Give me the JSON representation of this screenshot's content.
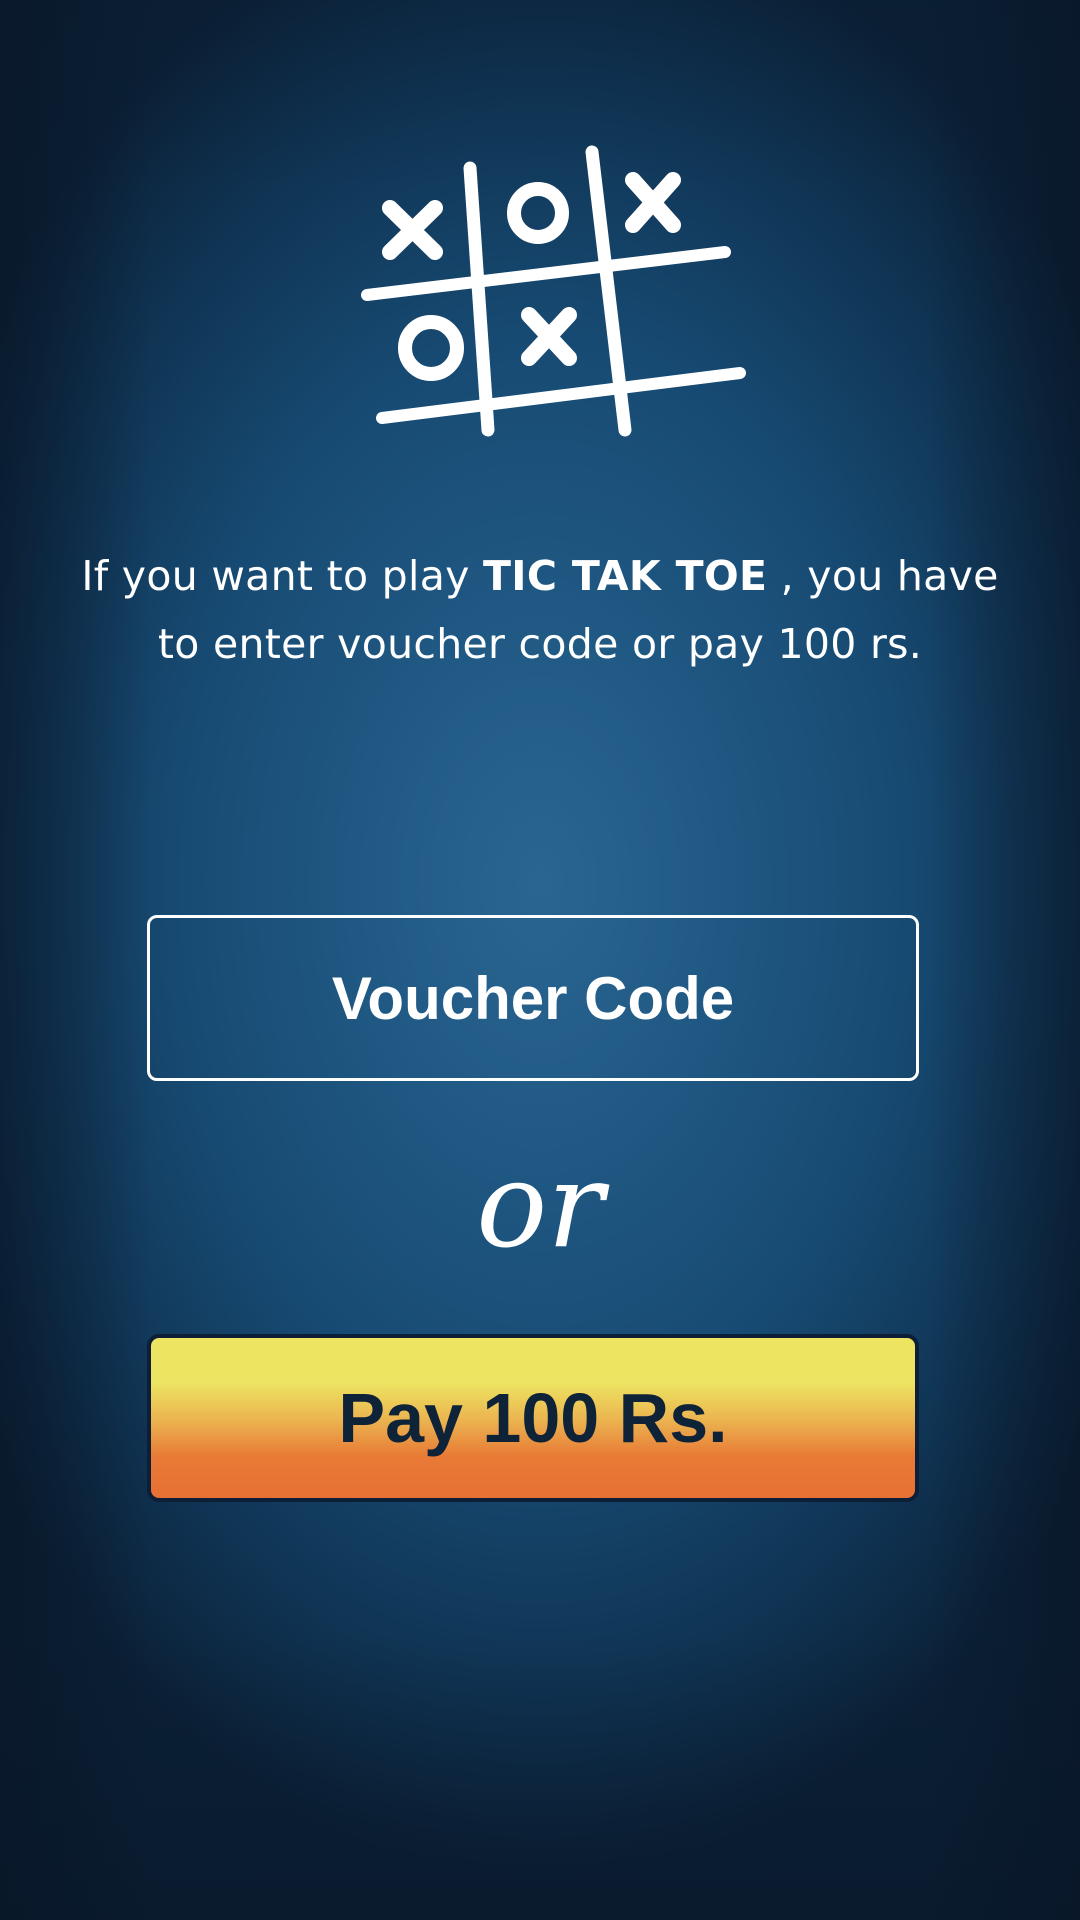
{
  "logo": {
    "icon": "tic-tac-toe-board-icon"
  },
  "intro": {
    "prefix": "If you want to play ",
    "game_name": "TIC TAK TOE",
    "suffix": " , you have to enter voucher code or pay 100 rs."
  },
  "voucher": {
    "placeholder": "Voucher Code",
    "value": ""
  },
  "separator": {
    "label": "or"
  },
  "pay": {
    "label": "Pay 100 Rs."
  },
  "colors": {
    "background_center": "#2a6591",
    "background_edge": "#0b2036",
    "pay_button_top": "#ede462",
    "pay_button_bottom": "#e87034",
    "pay_button_text": "#0e2238"
  }
}
